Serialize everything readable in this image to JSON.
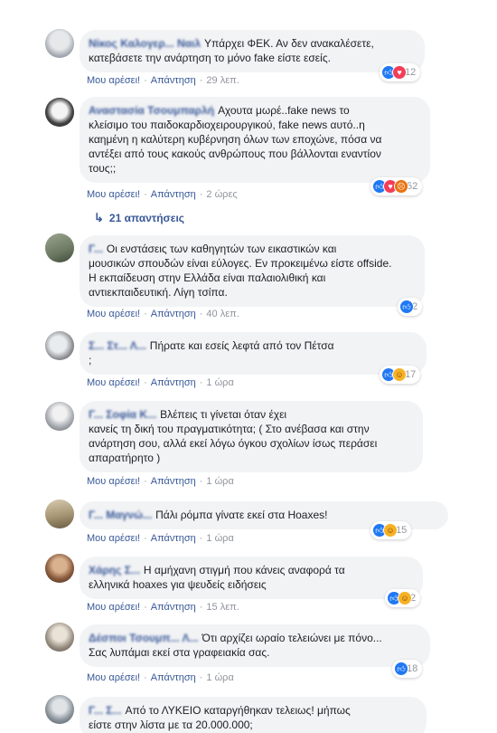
{
  "labels": {
    "like": "Μου αρέσει!",
    "reply": "Απάντηση",
    "separator": "·"
  },
  "colors": {
    "link": "#385898",
    "bubble": "#f2f3f5",
    "meta": "#90949c",
    "like_blue": "#2078f4",
    "love_red": "#f33e58",
    "haha_yellow": "#f7b125",
    "angry_orange": "#e9710f"
  },
  "comments": [
    {
      "author": "Νίκος Καλογερ... Ναιλ",
      "text": "Υπάρχει ΦΕΚ. Αν δεν ανακαλέσετε,\nκατεβάσετε την ανάρτηση το μόνο fake είστε εσείς.",
      "time": "29 λεπ.",
      "reaction_icons": [
        "like-icon",
        "love-icon"
      ],
      "reaction_count": "12"
    },
    {
      "author": "Αναστασία Τσουμπαρλή",
      "text": "Αχουτα μωρέ..fake news το\nκλείσιμο του παιδοκαρδιοχειρουργικού, fake news αυτό..η\nκαημένη η καλύτερη κυβέρνηση όλων των εποχώνε, πόσα να\nαντέξει από τους κακούς ανθρώπους που βάλλονται εναντίον\nτους;;",
      "time": "2 ώρες",
      "reaction_icons": [
        "like-icon",
        "love-icon",
        "angry-icon"
      ],
      "reaction_count": "52"
    },
    {
      "author": "Γ...",
      "text": "Οι ενστάσεις των καθηγητών των εικαστικών και\nμουσικών σπουδών είναι εύλογες. Εν προκειμένω είστε offside.\nΗ εκπαίδευση στην Ελλάδα είναι παλαιολιθική και\nαντιεκπαιδευτική. Λίγη τσίπα.",
      "time": "40 λεπ.",
      "reaction_icons": [
        "like-icon"
      ],
      "reaction_count": "2"
    },
    {
      "author": "Σ... Στ... Λ...",
      "text": "Πήρατε και εσείς λεφτά από τον Πέτσα\n;",
      "time": "1 ώρα",
      "reaction_icons": [
        "like-icon",
        "haha-icon"
      ],
      "reaction_count": "17"
    },
    {
      "author": "Γ... Σοφία Κ...",
      "text": "Βλέπεις τι γίνεται όταν έχει\nκανείς τη δική του πραγματικότητα; ( Στο ανέβασα και στην\nανάρτηση σου, αλλά εκεί λόγω όγκου σχολίων ίσως περάσει\nαπαρατήρητο )",
      "time": "1 ώρα",
      "reaction_icons": [],
      "reaction_count": ""
    },
    {
      "author": "Γ... Μαγνώ...",
      "text": "Πάλι ρόμπα γίνατε εκεί στα Hoaxes!",
      "time": "1 ώρα",
      "reaction_icons": [
        "like-icon",
        "haha-icon"
      ],
      "reaction_count": "15"
    },
    {
      "author": "Χάρης Σ...",
      "text": "Η αμήχανη στιγμή που κάνεις αναφορά τα\nελληνικά hoaxes για ψευδείς ειδήσεις",
      "time": "15 λεπ.",
      "reaction_icons": [
        "like-icon",
        "haha-icon"
      ],
      "reaction_count": "2"
    },
    {
      "author": "Δέσποι Τσουμπ... Λ...",
      "text": "Ότι αρχίζει ωραίο τελειώνει με πόνο...\nΣας λυπάμαι εκεί στα γραφειακία σας.",
      "time": "1 ώρα",
      "reaction_icons": [
        "like-icon"
      ],
      "reaction_count": "18"
    },
    {
      "author": "Γ... Σ...",
      "text": "Από το ΛΥΚΕΙΟ καταργήθηκαν τελειως! μήπως\nείστε στην λίστα με τα 20.000.000;",
      "time": "",
      "reaction_icons": [],
      "reaction_count": ""
    }
  ],
  "replies_link": "21 απαντήσεις"
}
